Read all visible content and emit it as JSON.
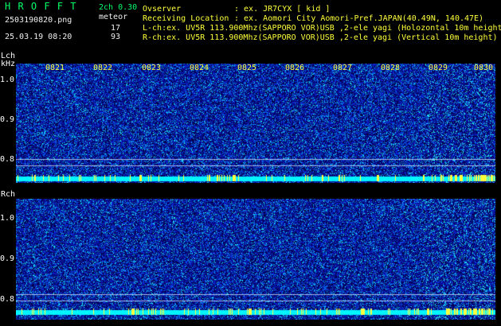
{
  "header": {
    "title": "H R O F F T",
    "version": "2ch 0.30",
    "filename": "2503190820.png",
    "mode": "meteor",
    "datetime": "25.03.19 08:20",
    "lch_count": "17",
    "rch_count": "93",
    "observer_label": "Ovserver",
    "observer_value": ": ex. JR7CYX [ kid ]",
    "location_label": "Receiving Location",
    "location_value": ": ex. Aomori City Aomori-Pref.JAPAN(40.49N, 140.47E)",
    "lch_info": "L-ch:ex. UV5R 113.900Mhz(SAPPORO VOR)USB ,2-ele yagi (Holozontal 10m height)",
    "rch_info": "R-ch:ex. UV5R 113.900Mhz(SAPPORO VOR)USB ,2-ele yagi (Vertical 10m height)"
  },
  "time_ticks": [
    "0821",
    "0822",
    "0823",
    "0824",
    "0825",
    "0826",
    "0827",
    "0828",
    "0829",
    "0830"
  ],
  "lch_panel": {
    "channel": "Lch",
    "unit": "kHz",
    "y_ticks": [
      "1.0",
      "0.9",
      "0.8"
    ]
  },
  "rch_panel": {
    "channel": "Rch",
    "y_ticks": [
      "1.0",
      "0.9",
      "0.8"
    ]
  },
  "colors": {
    "background": "#000000",
    "noise_blue": "#1a2ab8",
    "signal_cyan": "#00ffff",
    "tick_yellow": "#ffff3a",
    "title_green": "#00ff66"
  }
}
